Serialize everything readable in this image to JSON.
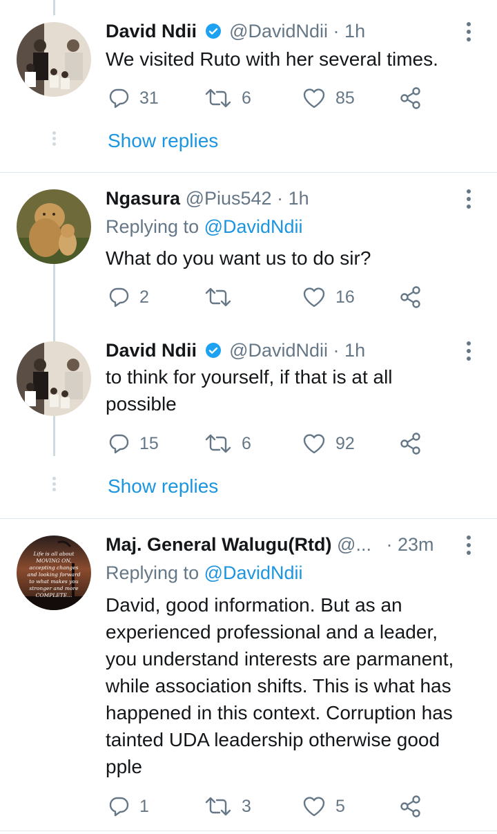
{
  "tweets": [
    {
      "name": "David Ndii",
      "handle": "@DavidNdii",
      "sep": "·",
      "time": "1h",
      "verified": true,
      "text": "We visited Ruto with her several times.",
      "replies": "31",
      "retweets": "6",
      "likes": "85",
      "show_replies": "Show replies"
    },
    {
      "name": "Ngasura",
      "handle": "@Pius542",
      "sep": "·",
      "time": "1h",
      "replying_prefix": "Replying to",
      "replying_to": "@DavidNdii",
      "text": "What do you want us to do sir?",
      "replies": "2",
      "retweets": "",
      "likes": "16"
    },
    {
      "name": "David Ndii",
      "handle": "@DavidNdii",
      "sep": "·",
      "time": "1h",
      "verified": true,
      "text_line1": "to think for yourself, if that is at all",
      "text_line2": "possible",
      "replies": "15",
      "retweets": "6",
      "likes": "92",
      "show_replies": "Show replies"
    },
    {
      "name": "Maj. General Walugu(Rtd)",
      "handle": "@...",
      "sep": "·",
      "time": "23m",
      "replying_prefix": "Replying to",
      "replying_to": "@DavidNdii",
      "text_lines": [
        "David, good information. But as an",
        "experienced professional and a leader,",
        "you understand interests are parmanent,",
        "while association shifts. This is what has",
        "happened in this context. Corruption has",
        "tainted UDA leadership otherwise good",
        "pple"
      ],
      "avatar_text": "Life is all about MOVING ON, accepting changes and looking forward to what makes you stronger and more COMPLETE...",
      "replies": "1",
      "retweets": "3",
      "likes": "5"
    }
  ],
  "colors": {
    "link": "#1b95e0",
    "secondary": "#657786",
    "thread_line": "#cfd9de",
    "divider": "#e1e8ed"
  }
}
